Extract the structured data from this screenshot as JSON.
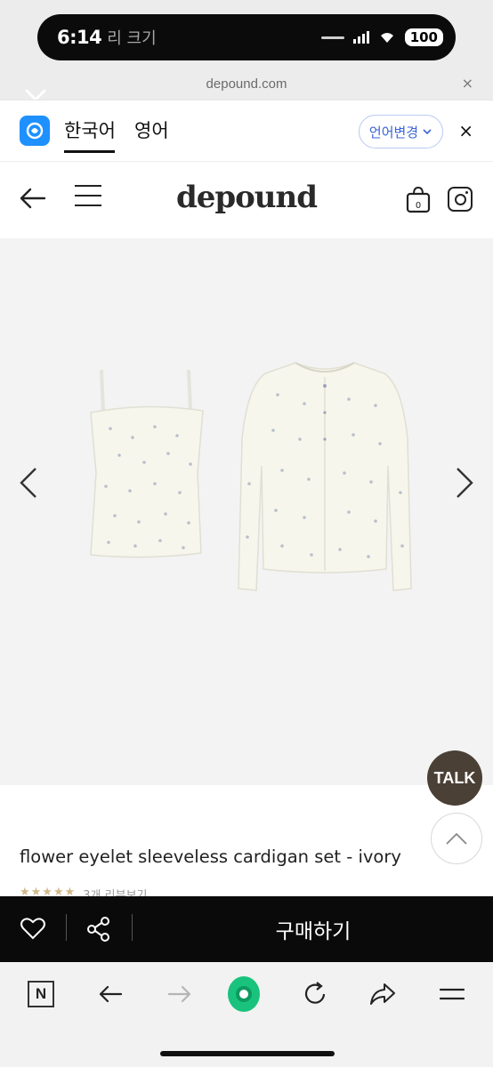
{
  "status_bar": {
    "time": "6:14",
    "ghost_text": "리 크기",
    "battery": "100"
  },
  "browser": {
    "url": "depound.com",
    "close_glyph": "×"
  },
  "translate_bar": {
    "lang_korean": "한국어",
    "lang_english": "영어",
    "change_language": "언어변경",
    "close_glyph": "×"
  },
  "site_header": {
    "logo": "depound",
    "cart_count": "0"
  },
  "product": {
    "title": "flower eyelet sleeveless cardigan set - ivory",
    "stars": "★★★★★",
    "review_text": "3개 리뷰보기"
  },
  "floating": {
    "talk_label": "TALK"
  },
  "purchase_bar": {
    "buy_label": "구매하기"
  },
  "browser_bar": {
    "n_label": "N"
  },
  "colors": {
    "accent_blue": "#3a63d8",
    "papago_blue": "#1e90ff",
    "talk_brown": "#4a4035",
    "buy_bar_bg": "#0a0a0a",
    "naver_green": "#19c37d"
  }
}
